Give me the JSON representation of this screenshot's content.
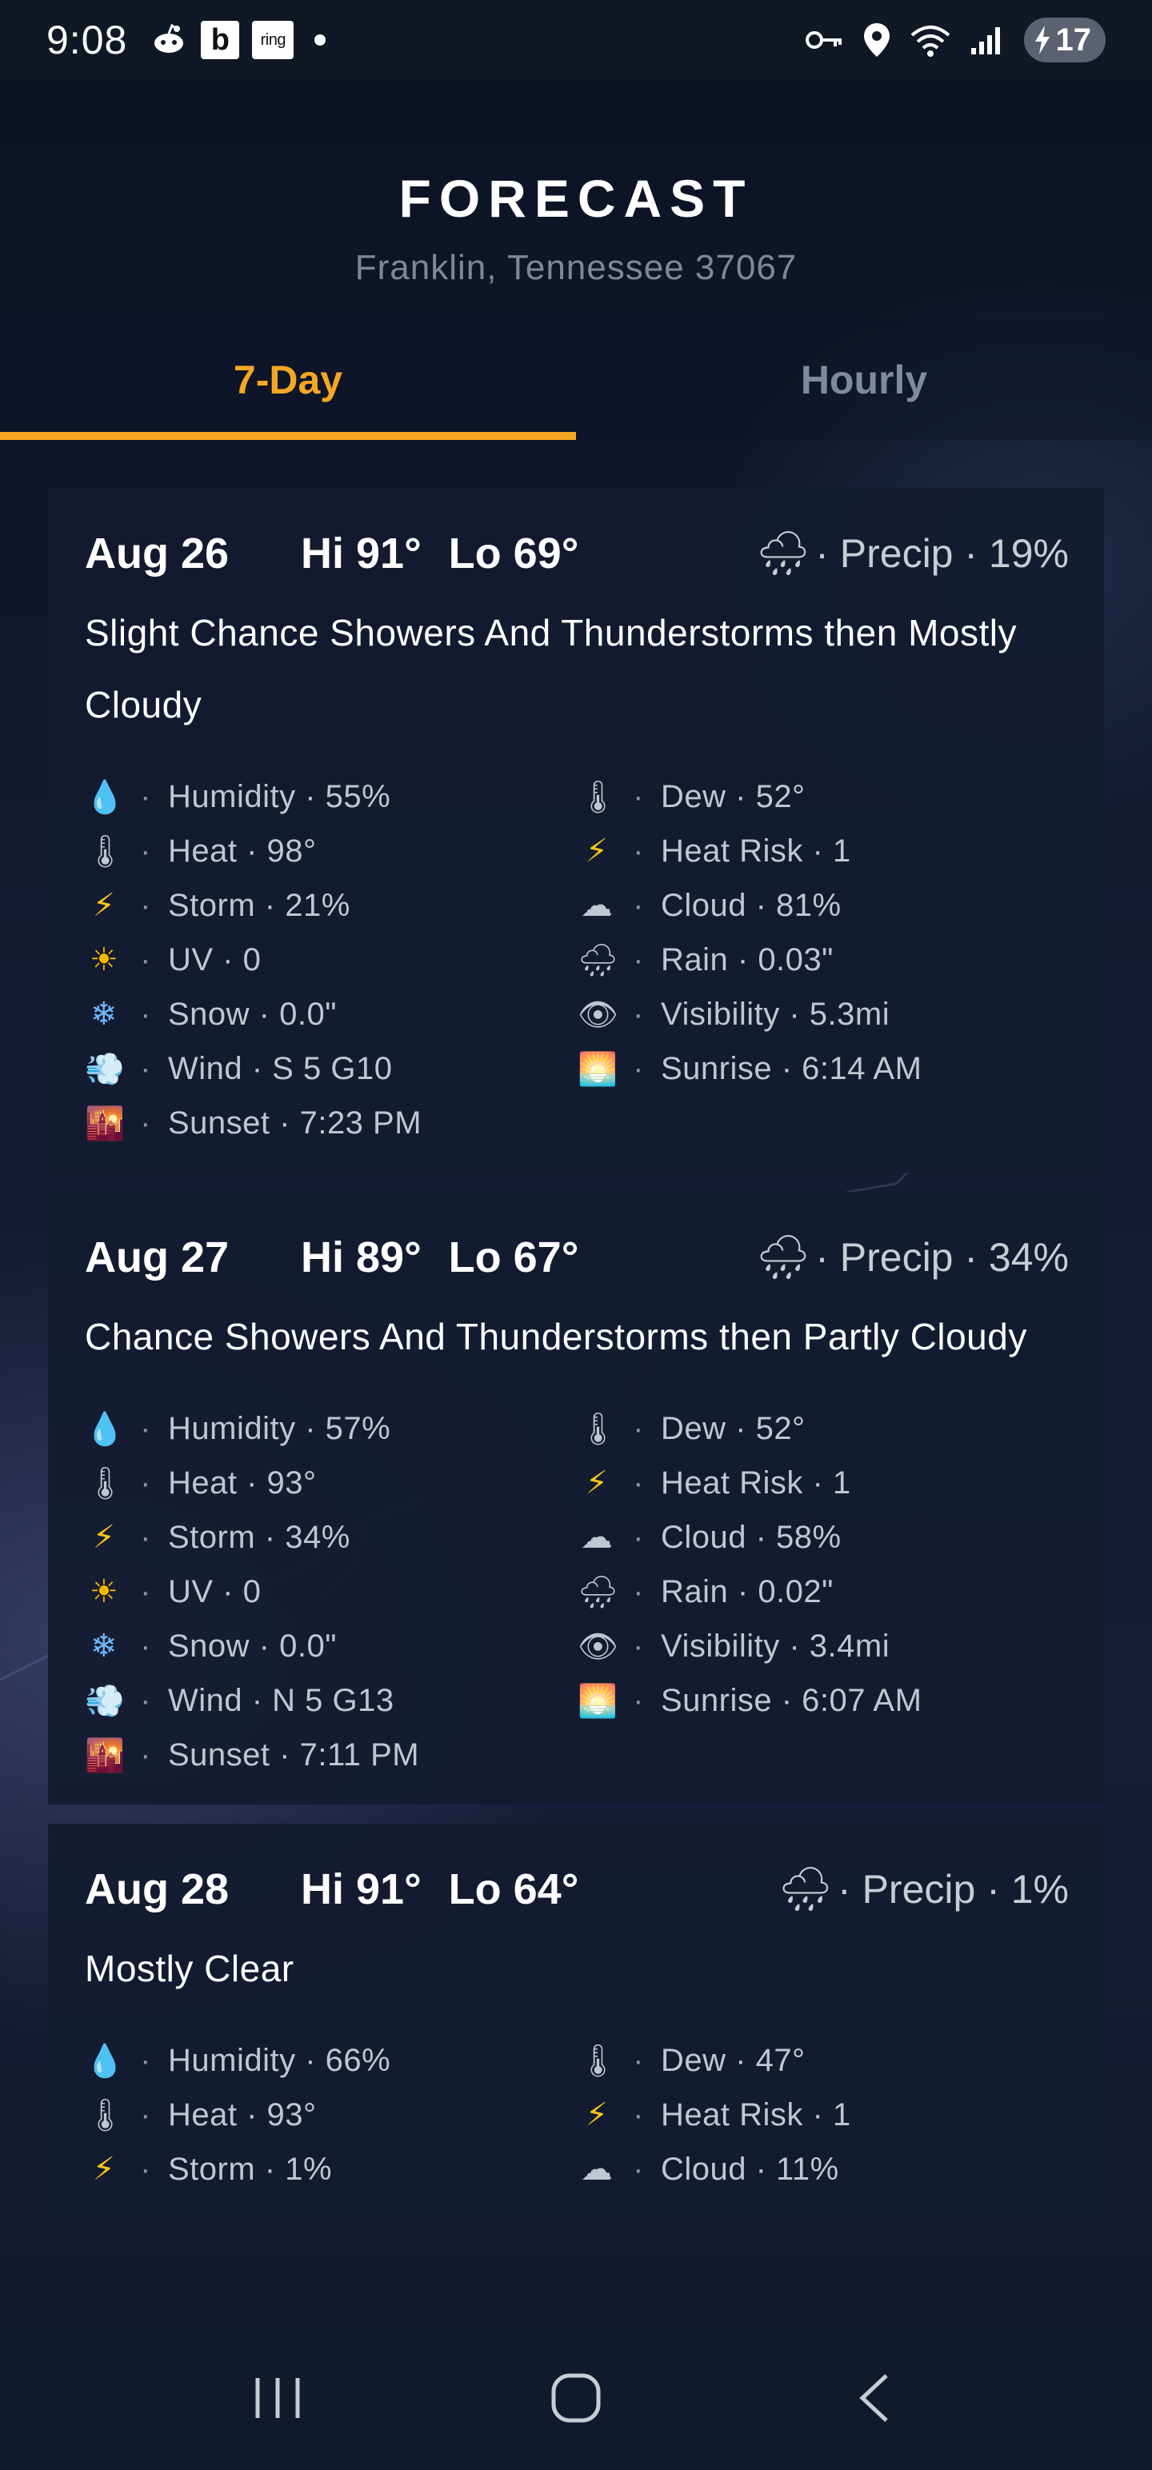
{
  "status_bar": {
    "time": "9:08",
    "app_icons": [
      "notification-icon",
      "b",
      "ring"
    ],
    "battery": "17"
  },
  "header": {
    "title": "FORECAST",
    "location": "Franklin, Tennessee 37067"
  },
  "tabs": [
    {
      "label": "7-Day",
      "active": true
    },
    {
      "label": "Hourly",
      "active": false
    }
  ],
  "accent_color": "#f5a623",
  "days": [
    {
      "date": "Aug 26",
      "hi": "Hi 91°",
      "lo": "Lo 69°",
      "precip": "· Precip · 19%",
      "description": "Slight Chance Showers And Thunderstorms then Mostly Cloudy",
      "stats": {
        "humidity": "Humidity · 55%",
        "dew": "Dew · 52°",
        "heat": "Heat · 98°",
        "heat_risk": "Heat Risk · 1",
        "storm": "Storm · 21%",
        "cloud": "Cloud · 81%",
        "uv": "UV · 0",
        "rain": "Rain · 0.03\"",
        "snow": "Snow · 0.0\"",
        "visibility": "Visibility · 5.3mi",
        "wind": "Wind · S 5 G10",
        "sunrise": "Sunrise · 6:14 AM",
        "sunset": "Sunset · 7:23 PM"
      }
    },
    {
      "date": "Aug 27",
      "hi": "Hi 89°",
      "lo": "Lo 67°",
      "precip": "· Precip · 34%",
      "description": "Chance Showers And Thunderstorms then Partly Cloudy",
      "stats": {
        "humidity": "Humidity · 57%",
        "dew": "Dew · 52°",
        "heat": "Heat · 93°",
        "heat_risk": "Heat Risk · 1",
        "storm": "Storm · 34%",
        "cloud": "Cloud · 58%",
        "uv": "UV · 0",
        "rain": "Rain · 0.02\"",
        "snow": "Snow · 0.0\"",
        "visibility": "Visibility · 3.4mi",
        "wind": "Wind · N 5 G13",
        "sunrise": "Sunrise · 6:07 AM",
        "sunset": "Sunset · 7:11 PM"
      }
    },
    {
      "date": "Aug 28",
      "hi": "Hi 91°",
      "lo": "Lo 64°",
      "precip": "· Precip · 1%",
      "description": "Mostly Clear",
      "stats": {
        "humidity": "Humidity · 66%",
        "dew": "Dew · 47°",
        "heat": "Heat · 93°",
        "heat_risk": "Heat Risk · 1",
        "storm": "Storm · 1%",
        "cloud": "Cloud · 11%"
      }
    }
  ],
  "icons": {
    "humidity": "droplet-icon",
    "dew": "thermometer-icon",
    "heat": "thermometer-icon",
    "heat_risk": "lightning-icon",
    "storm": "lightning-icon",
    "cloud": "cloud-icon",
    "uv": "sun-icon",
    "rain": "rain-cloud-icon",
    "snow": "snowflake-icon",
    "visibility": "eye-icon",
    "wind": "wind-icon",
    "sunrise": "sunrise-icon",
    "sunset": "sunset-icon",
    "precip": "rain-cloud-icon"
  },
  "nav": [
    "recent-apps-button",
    "home-button",
    "back-button"
  ]
}
